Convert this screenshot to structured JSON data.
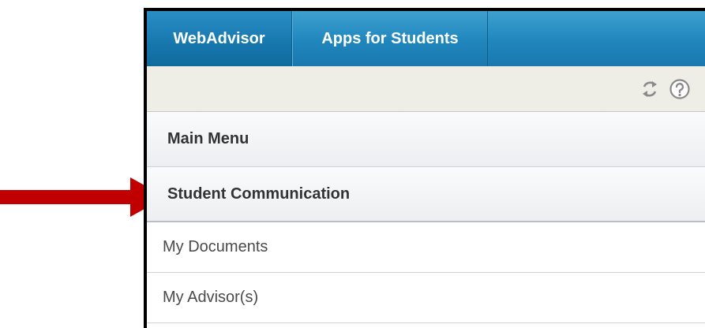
{
  "tabs": [
    {
      "label": "WebAdvisor",
      "active": true
    },
    {
      "label": "Apps for Students",
      "active": false
    }
  ],
  "toolbar": {
    "icons": [
      "refresh-icon",
      "help-icon"
    ]
  },
  "menu": {
    "headers": [
      "Main Menu",
      "Student Communication"
    ],
    "items": [
      "My Documents",
      "My Advisor(s)"
    ]
  },
  "colors": {
    "tab_blue": "#1f86bd",
    "toolbar_bg": "#efeee6",
    "arrow_red": "#c00000",
    "text_dark": "#333333"
  }
}
